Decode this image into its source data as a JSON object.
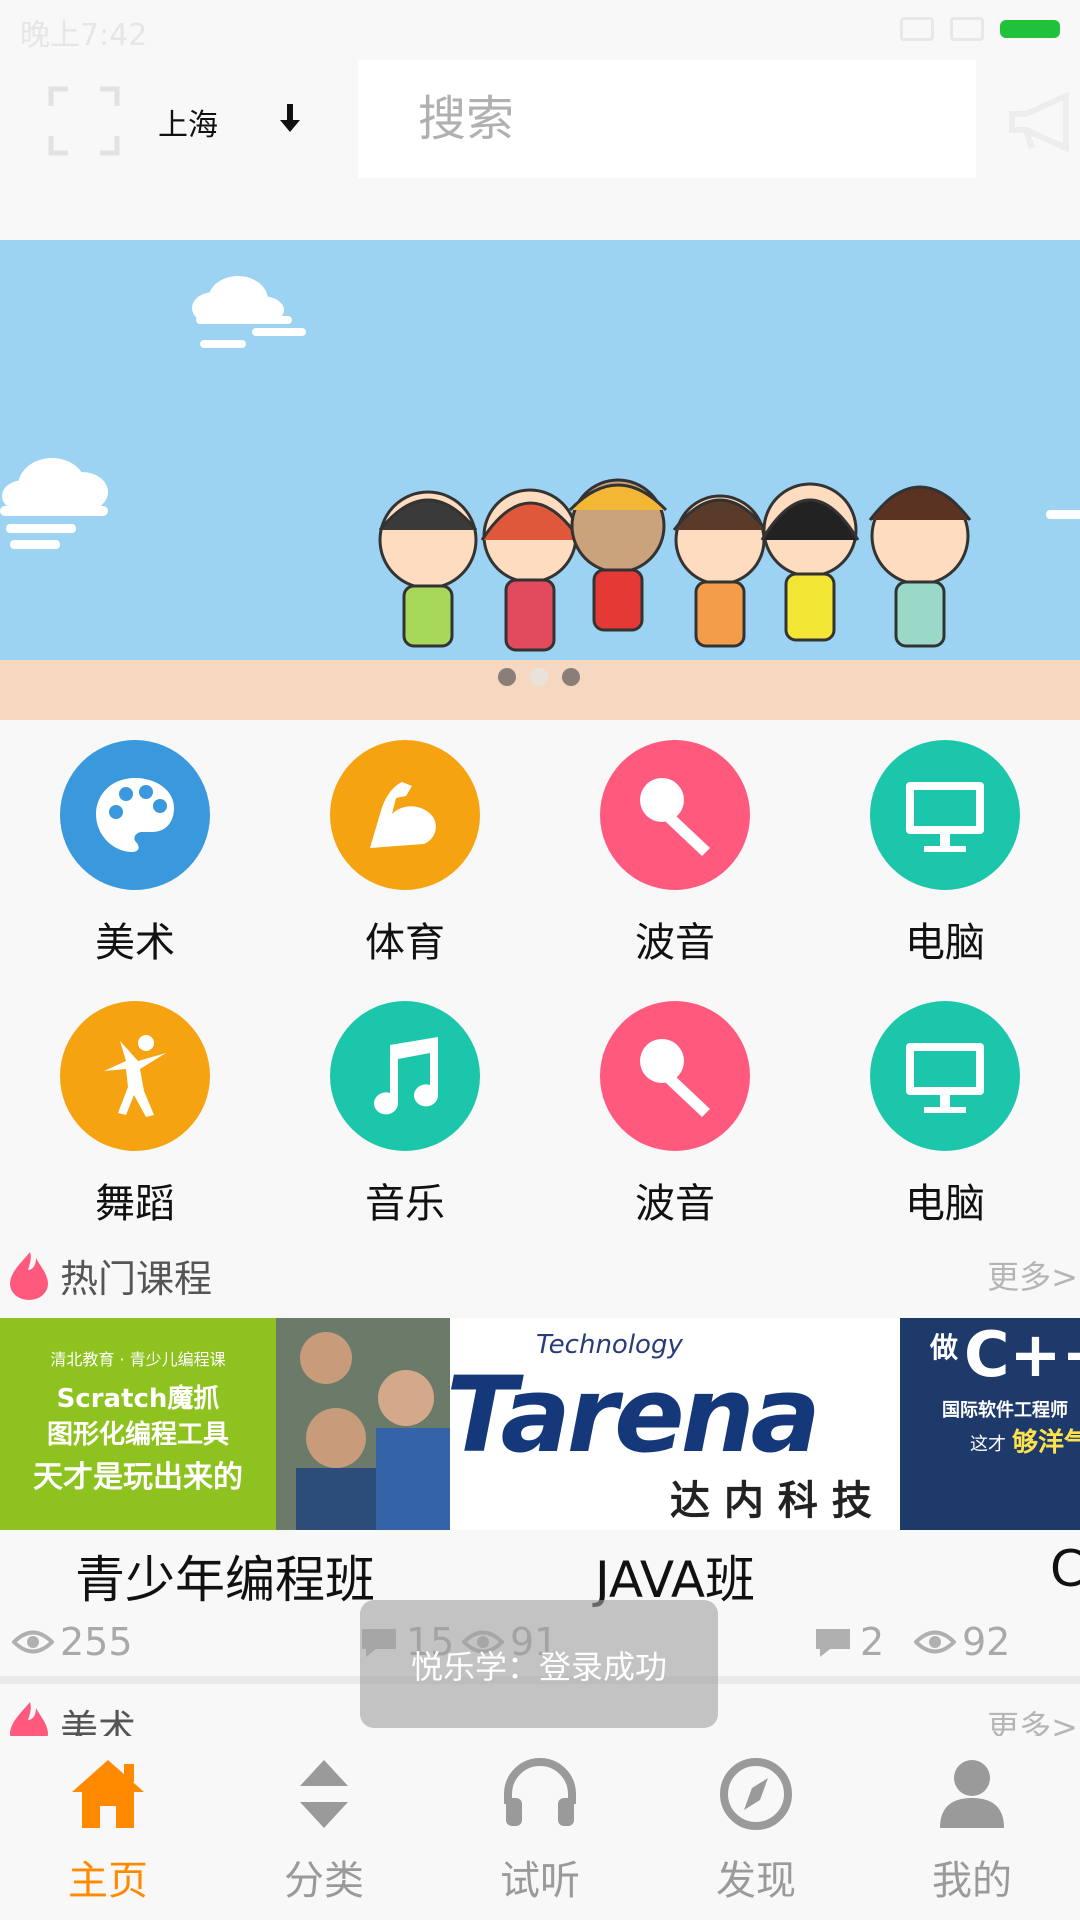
{
  "status_bar": {
    "time": "晚上7:42"
  },
  "header": {
    "city": "上海",
    "search_placeholder": "搜索"
  },
  "categories": [
    {
      "label": "美术",
      "icon": "palette-icon",
      "color": "#3a98dc"
    },
    {
      "label": "体育",
      "icon": "muscle-arm-icon",
      "color": "#f5a311"
    },
    {
      "label": "波音",
      "icon": "microphone-icon",
      "color": "#ff5a7d"
    },
    {
      "label": "电脑",
      "icon": "monitor-icon",
      "color": "#1cc6ab"
    },
    {
      "label": "舞蹈",
      "icon": "dancer-icon",
      "color": "#f5a311"
    },
    {
      "label": "音乐",
      "icon": "music-note-icon",
      "color": "#1cc6ab"
    },
    {
      "label": "波音",
      "icon": "microphone-icon",
      "color": "#ff5a7d"
    },
    {
      "label": "电脑",
      "icon": "monitor-icon",
      "color": "#1cc6ab"
    }
  ],
  "hot_section": {
    "title": "热门课程",
    "more": "更多>"
  },
  "courses": [
    {
      "name": "青少年编程班",
      "views": "255",
      "image_text": {
        "line1": "清北教育 · 青少儿编程课",
        "line2": "Scratch魔抓",
        "line3": "图形化编程工具",
        "line4": "天才是玩出来的"
      }
    },
    {
      "name": "JAVA班",
      "comments": "15",
      "views": "91",
      "image_text": {
        "line1": "Technology",
        "line2": "Tarena",
        "line3": "达 内 科 技"
      }
    },
    {
      "name": "C",
      "comments": "2",
      "views": "92",
      "image_text": {
        "line1": "做",
        "line2": "C++",
        "line3": "国际软件工程师",
        "line4": "这才",
        "line5": "够洋气"
      }
    }
  ],
  "art_section": {
    "title": "美术",
    "more": "更多>"
  },
  "toast": "悦乐学：登录成功",
  "bottom_nav": [
    {
      "label": "主页",
      "icon": "home-icon",
      "active": true
    },
    {
      "label": "分类",
      "icon": "sort-icon",
      "active": false
    },
    {
      "label": "试听",
      "icon": "headphones-icon",
      "active": false
    },
    {
      "label": "发现",
      "icon": "compass-icon",
      "active": false
    },
    {
      "label": "我的",
      "icon": "user-icon",
      "active": false
    }
  ],
  "colors": {
    "accent": "#ff8a00",
    "banner_sky": "#9cd3f2",
    "flame": "#ff5a7d"
  }
}
